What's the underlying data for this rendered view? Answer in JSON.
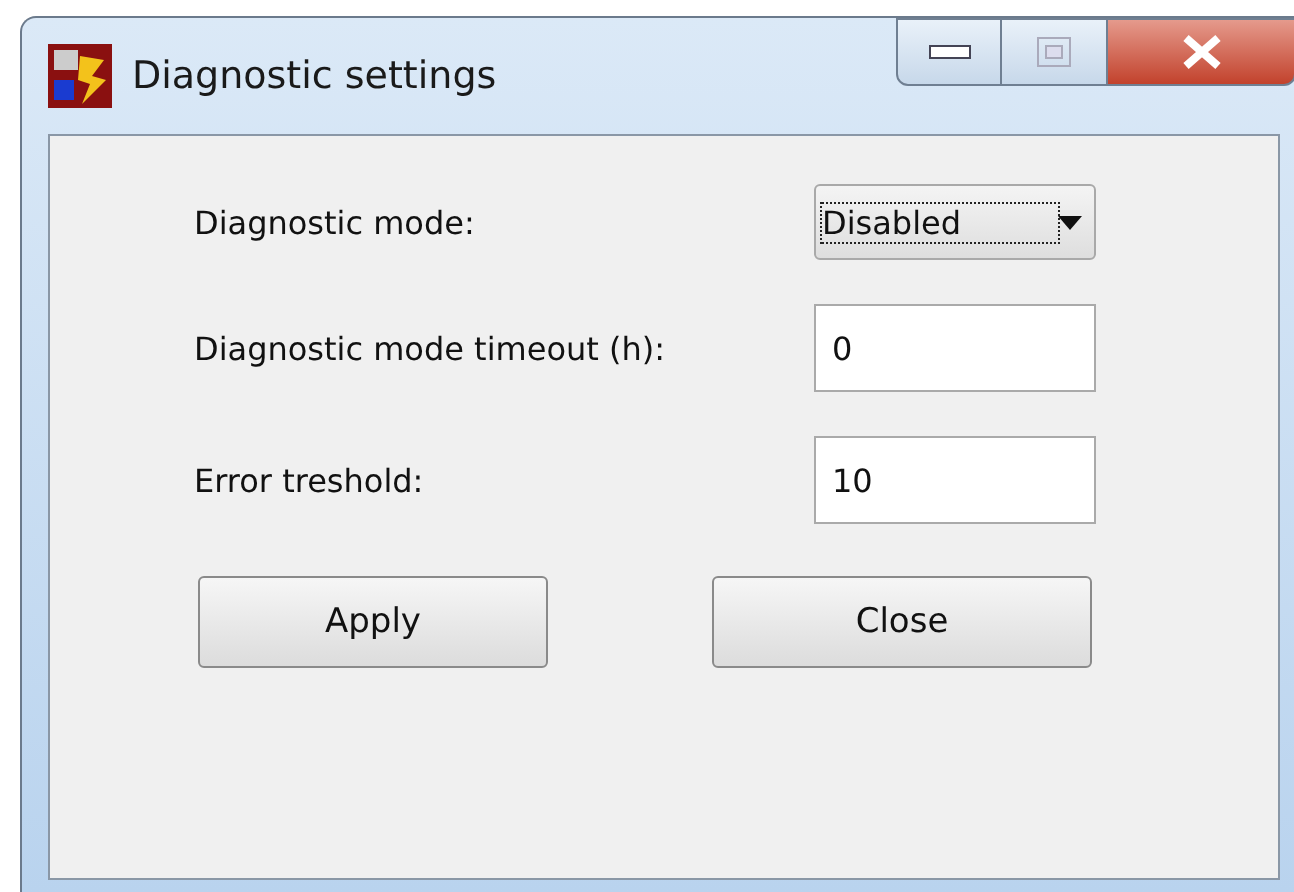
{
  "window": {
    "title": "Diagnostic settings"
  },
  "fields": [
    {
      "label": "Diagnostic mode:",
      "kind": "dropdown",
      "value": "Disabled",
      "focused": true
    },
    {
      "label": "Diagnostic mode timeout (h):",
      "kind": "text",
      "value": "0",
      "focused": false
    },
    {
      "label": "Error treshold:",
      "kind": "text",
      "value": "10",
      "focused": false
    }
  ],
  "buttons": [
    "Apply",
    "Close"
  ]
}
